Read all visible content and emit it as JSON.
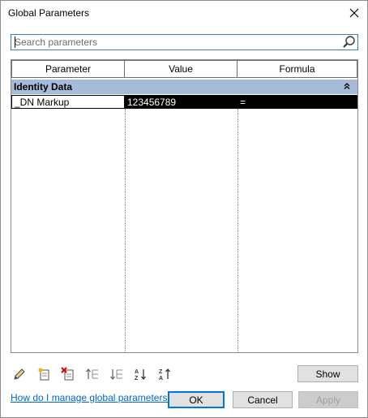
{
  "window": {
    "title": "Global Parameters"
  },
  "search": {
    "placeholder": "Search parameters"
  },
  "grid": {
    "columns": [
      "Parameter",
      "Value",
      "Formula"
    ],
    "groups": [
      {
        "name": "Identity Data",
        "rows": [
          {
            "parameter": "_DN Markup",
            "value": "123456789",
            "formula": "="
          }
        ]
      }
    ]
  },
  "toolbar": {
    "icons": [
      "pencil-icon",
      "new-parameter-icon",
      "delete-parameter-icon",
      "move-up-icon",
      "move-down-icon",
      "sort-ascending-icon",
      "sort-descending-icon"
    ]
  },
  "buttons": {
    "show": "Show",
    "ok": "OK",
    "cancel": "Cancel",
    "apply": "Apply"
  },
  "help": {
    "link_text": "How do I manage global parameters?"
  },
  "colors": {
    "group_header": "#a6bbd8",
    "selected_cell": "#000000",
    "link": "#0066cc",
    "focus_border": "#0078d7"
  }
}
